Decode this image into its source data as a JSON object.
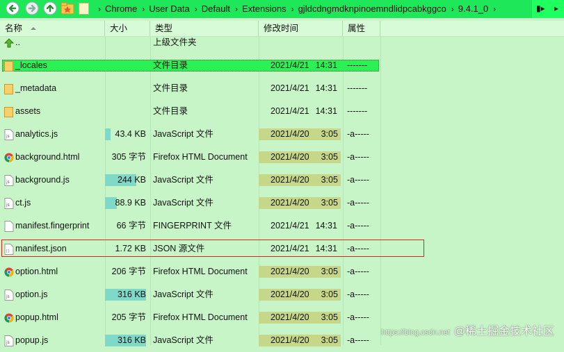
{
  "breadcrumbs": [
    "Chrome",
    "User Data",
    "Default",
    "Extensions",
    "gjldcdngmdknpinoemndlidpcabkggco",
    "9.4.1_0"
  ],
  "columns": {
    "name": "名称",
    "size": "大小",
    "type": "类型",
    "modified": "修改时间",
    "attr": "属性"
  },
  "rows": [
    {
      "icon": "folder-up-icon",
      "name": "..",
      "size": "",
      "size_fill": 0,
      "type": "上级文件夹",
      "date": "",
      "time": "",
      "attr": "",
      "date_highlight": false
    },
    {
      "icon": "folder-icon",
      "name": "_locales",
      "size": "",
      "size_fill": 0,
      "type": "文件目录",
      "date": "2021/4/21",
      "time": "14:31",
      "attr": "-------",
      "date_highlight": false,
      "selected": true
    },
    {
      "icon": "folder-icon",
      "name": "_metadata",
      "size": "",
      "size_fill": 0,
      "type": "文件目录",
      "date": "2021/4/21",
      "time": "14:31",
      "attr": "-------",
      "date_highlight": false
    },
    {
      "icon": "folder-icon",
      "name": "assets",
      "size": "",
      "size_fill": 0,
      "type": "文件目录",
      "date": "2021/4/21",
      "time": "14:31",
      "attr": "-------",
      "date_highlight": false
    },
    {
      "icon": "js-file-icon",
      "name": "analytics.js",
      "size": "43.4 KB",
      "size_fill": 0.14,
      "type": "JavaScript 文件",
      "date": "2021/4/20",
      "time": "3:05",
      "attr": "-a-----",
      "date_highlight": true
    },
    {
      "icon": "chrome-html-icon",
      "name": "background.html",
      "size": "305 字节",
      "size_fill": 0,
      "type": "Firefox HTML Document",
      "date": "2021/4/20",
      "time": "3:05",
      "attr": "-a-----",
      "date_highlight": true
    },
    {
      "icon": "js-file-icon",
      "name": "background.js",
      "size": "244 KB",
      "size_fill": 0.77,
      "type": "JavaScript 文件",
      "date": "2021/4/20",
      "time": "3:05",
      "attr": "-a-----",
      "date_highlight": true
    },
    {
      "icon": "js-file-icon",
      "name": "ct.js",
      "size": "88.9 KB",
      "size_fill": 0.28,
      "type": "JavaScript 文件",
      "date": "2021/4/20",
      "time": "3:05",
      "attr": "-a-----",
      "date_highlight": true
    },
    {
      "icon": "blank-file-icon",
      "name": "manifest.fingerprint",
      "size": "66 字节",
      "size_fill": 0,
      "type": "FINGERPRINT 文件",
      "date": "2021/4/21",
      "time": "14:31",
      "attr": "-a-----",
      "date_highlight": false
    },
    {
      "icon": "json-file-icon",
      "name": "manifest.json",
      "size": "1.72 KB",
      "size_fill": 0,
      "type": "JSON 源文件",
      "date": "2021/4/21",
      "time": "14:31",
      "attr": "-a-----",
      "date_highlight": false
    },
    {
      "icon": "chrome-html-icon",
      "name": "option.html",
      "size": "206 字节",
      "size_fill": 0,
      "type": "Firefox HTML Document",
      "date": "2021/4/20",
      "time": "3:05",
      "attr": "-a-----",
      "date_highlight": true
    },
    {
      "icon": "js-file-icon",
      "name": "option.js",
      "size": "316 KB",
      "size_fill": 1.0,
      "type": "JavaScript 文件",
      "date": "2021/4/20",
      "time": "3:05",
      "attr": "-a-----",
      "date_highlight": true
    },
    {
      "icon": "chrome-html-icon",
      "name": "popup.html",
      "size": "205 字节",
      "size_fill": 0,
      "type": "Firefox HTML Document",
      "date": "2021/4/20",
      "time": "3:05",
      "attr": "-a-----",
      "date_highlight": true
    },
    {
      "icon": "js-file-icon",
      "name": "popup.js",
      "size": "316 KB",
      "size_fill": 1.0,
      "type": "JavaScript 文件",
      "date": "2021/4/20",
      "time": "3:05",
      "attr": "-a-----",
      "date_highlight": true
    }
  ],
  "watermark": {
    "url": "https://blog.csdn.net",
    "text": "@稀土掘金技术社区"
  },
  "colors": {
    "toolbar": "#1ee85a",
    "background": "#c8f5c8",
    "selected": "#2cf154",
    "size_bar": "#7fd9c9",
    "date_highlight": "#c7d789",
    "highlight_box": "#e0201e"
  }
}
